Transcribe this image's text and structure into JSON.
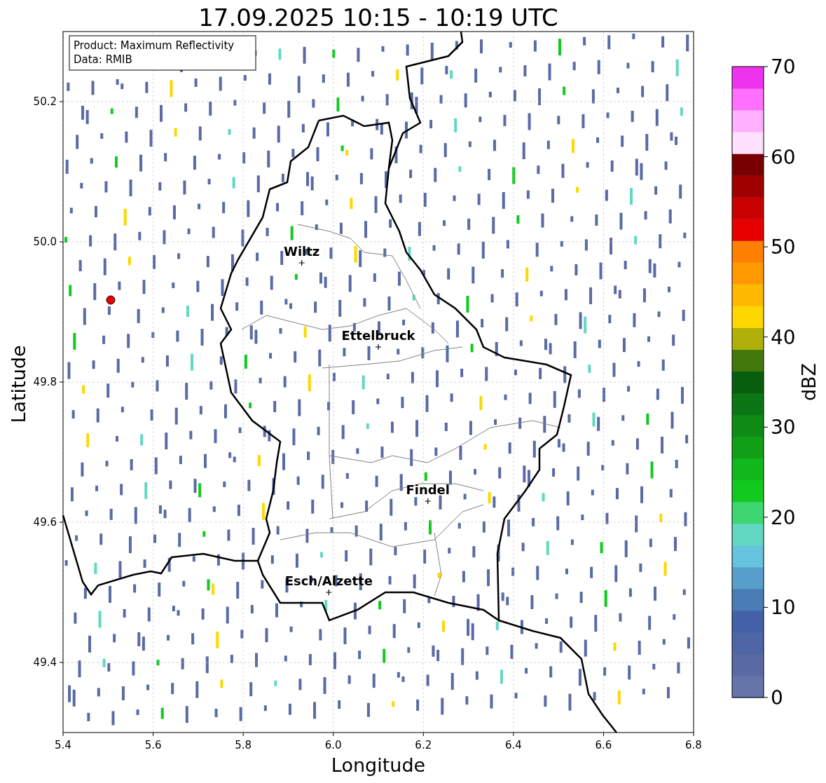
{
  "title": "17.09.2025 10:15 - 10:19 UTC",
  "legend": [
    "Product: Maximum Reflectivity",
    "Data: RMIB"
  ],
  "xlabel": "Longitude",
  "ylabel": "Latitude",
  "xticks": [
    "5.4",
    "5.6",
    "5.8",
    "6.0",
    "6.2",
    "6.4",
    "6.6",
    "6.8"
  ],
  "yticks": [
    "50.2",
    "50.0",
    "49.8",
    "49.6",
    "49.4"
  ],
  "places": [
    {
      "name": "Wiltz"
    },
    {
      "name": "Ettelbruck"
    },
    {
      "name": "Findel"
    },
    {
      "name": "Esch/Alzette"
    }
  ],
  "colorbar": {
    "label": "dBZ",
    "ticks": [
      "70",
      "60",
      "50",
      "40",
      "30",
      "20",
      "10",
      "0"
    ],
    "segments": [
      {
        "color": "#6675a8"
      },
      {
        "color": "#5a6aa4"
      },
      {
        "color": "#4e65a6"
      },
      {
        "color": "#4361a8"
      },
      {
        "color": "#4a7cb6"
      },
      {
        "color": "#579fca"
      },
      {
        "color": "#65c3dc"
      },
      {
        "color": "#62d8c2"
      },
      {
        "color": "#3dd671"
      },
      {
        "color": "#12c920"
      },
      {
        "color": "#11b81b"
      },
      {
        "color": "#109f17"
      },
      {
        "color": "#0e8a15"
      },
      {
        "color": "#0b7613"
      },
      {
        "color": "#075e0d"
      },
      {
        "color": "#43780c"
      },
      {
        "color": "#b0b00a"
      },
      {
        "color": "#ffd700"
      },
      {
        "color": "#ffb800"
      },
      {
        "color": "#ff9900"
      },
      {
        "color": "#ff7f00"
      },
      {
        "color": "#e60000"
      },
      {
        "color": "#c80000"
      },
      {
        "color": "#a00000"
      },
      {
        "color": "#780000"
      },
      {
        "color": "#ffe0ff"
      },
      {
        "color": "#ffb0ff"
      },
      {
        "color": "#ff70ff"
      },
      {
        "color": "#ee33ee"
      }
    ]
  }
}
